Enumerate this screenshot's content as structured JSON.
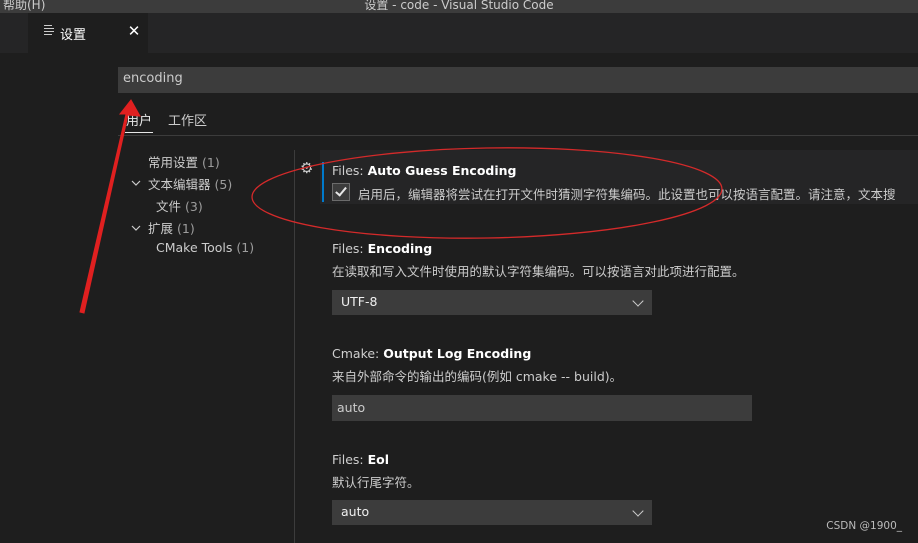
{
  "window": {
    "menu_help": "帮助(H)",
    "title": "设置 - code - Visual Studio Code"
  },
  "tab": {
    "label": "设置",
    "close": "✕",
    "icon": "settings-list-icon"
  },
  "search": {
    "value": "encoding"
  },
  "scope_tabs": {
    "user": "用户",
    "workspace": "工作区"
  },
  "toc": {
    "items": [
      {
        "label": "常用设置",
        "count": "(1)"
      },
      {
        "label": "文本编辑器",
        "count": "(5)",
        "expanded": true
      },
      {
        "label": "文件",
        "count": "(3)"
      },
      {
        "label": "扩展",
        "count": "(1)",
        "expanded": true
      },
      {
        "label": "CMake Tools",
        "count": "(1)"
      }
    ]
  },
  "settings": {
    "auto_guess": {
      "category": "Files: ",
      "name": "Auto Guess Encoding",
      "description": "启用后，编辑器将尝试在打开文件时猜测字符集编码。此设置也可以按语言配置。请注意，文本搜",
      "checked": true
    },
    "encoding": {
      "category": "Files: ",
      "name": "Encoding",
      "description": "在读取和写入文件时使用的默认字符集编码。可以按语言对此项进行配置。",
      "value": "UTF-8"
    },
    "cmake_log": {
      "category": "Cmake: ",
      "name": "Output Log Encoding",
      "description": "来自外部命令的输出的编码(例如 cmake -- build)。",
      "value": "auto"
    },
    "eol": {
      "category": "Files: ",
      "name": "Eol",
      "description": "默认行尾字符。",
      "value": "auto"
    }
  },
  "watermark": "CSDN @1900_",
  "colors": {
    "accent": "#007acc",
    "annotation": "#e02020"
  }
}
